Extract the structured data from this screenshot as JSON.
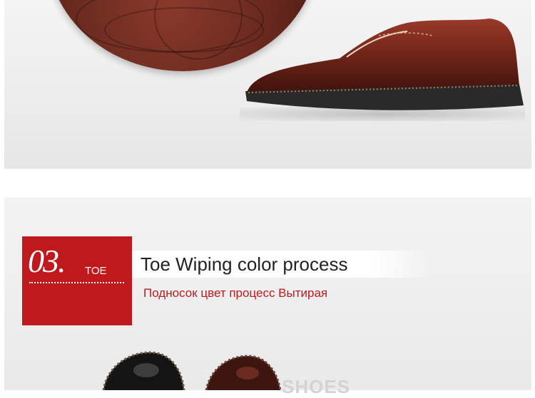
{
  "section": {
    "number": "03.",
    "word": "TOE",
    "title_en": "Toe Wiping color process",
    "title_ru": "Подносок цвет процесс Вытирая",
    "watermark": "SHOES"
  },
  "colors": {
    "accent": "#c0191d",
    "leather_brown": "#6b2a1f",
    "sole": "#2a2a2a",
    "panel_bg": "#ececec"
  },
  "images": [
    {
      "name": "leather-closeup",
      "description": "brown leather close-up"
    },
    {
      "name": "brown-oxford-shoe",
      "description": "brown oxford shoe"
    },
    {
      "name": "black-shoe-toe",
      "description": "black shoe toe"
    },
    {
      "name": "brown-shoe-toe",
      "description": "brown shoe toe"
    }
  ]
}
